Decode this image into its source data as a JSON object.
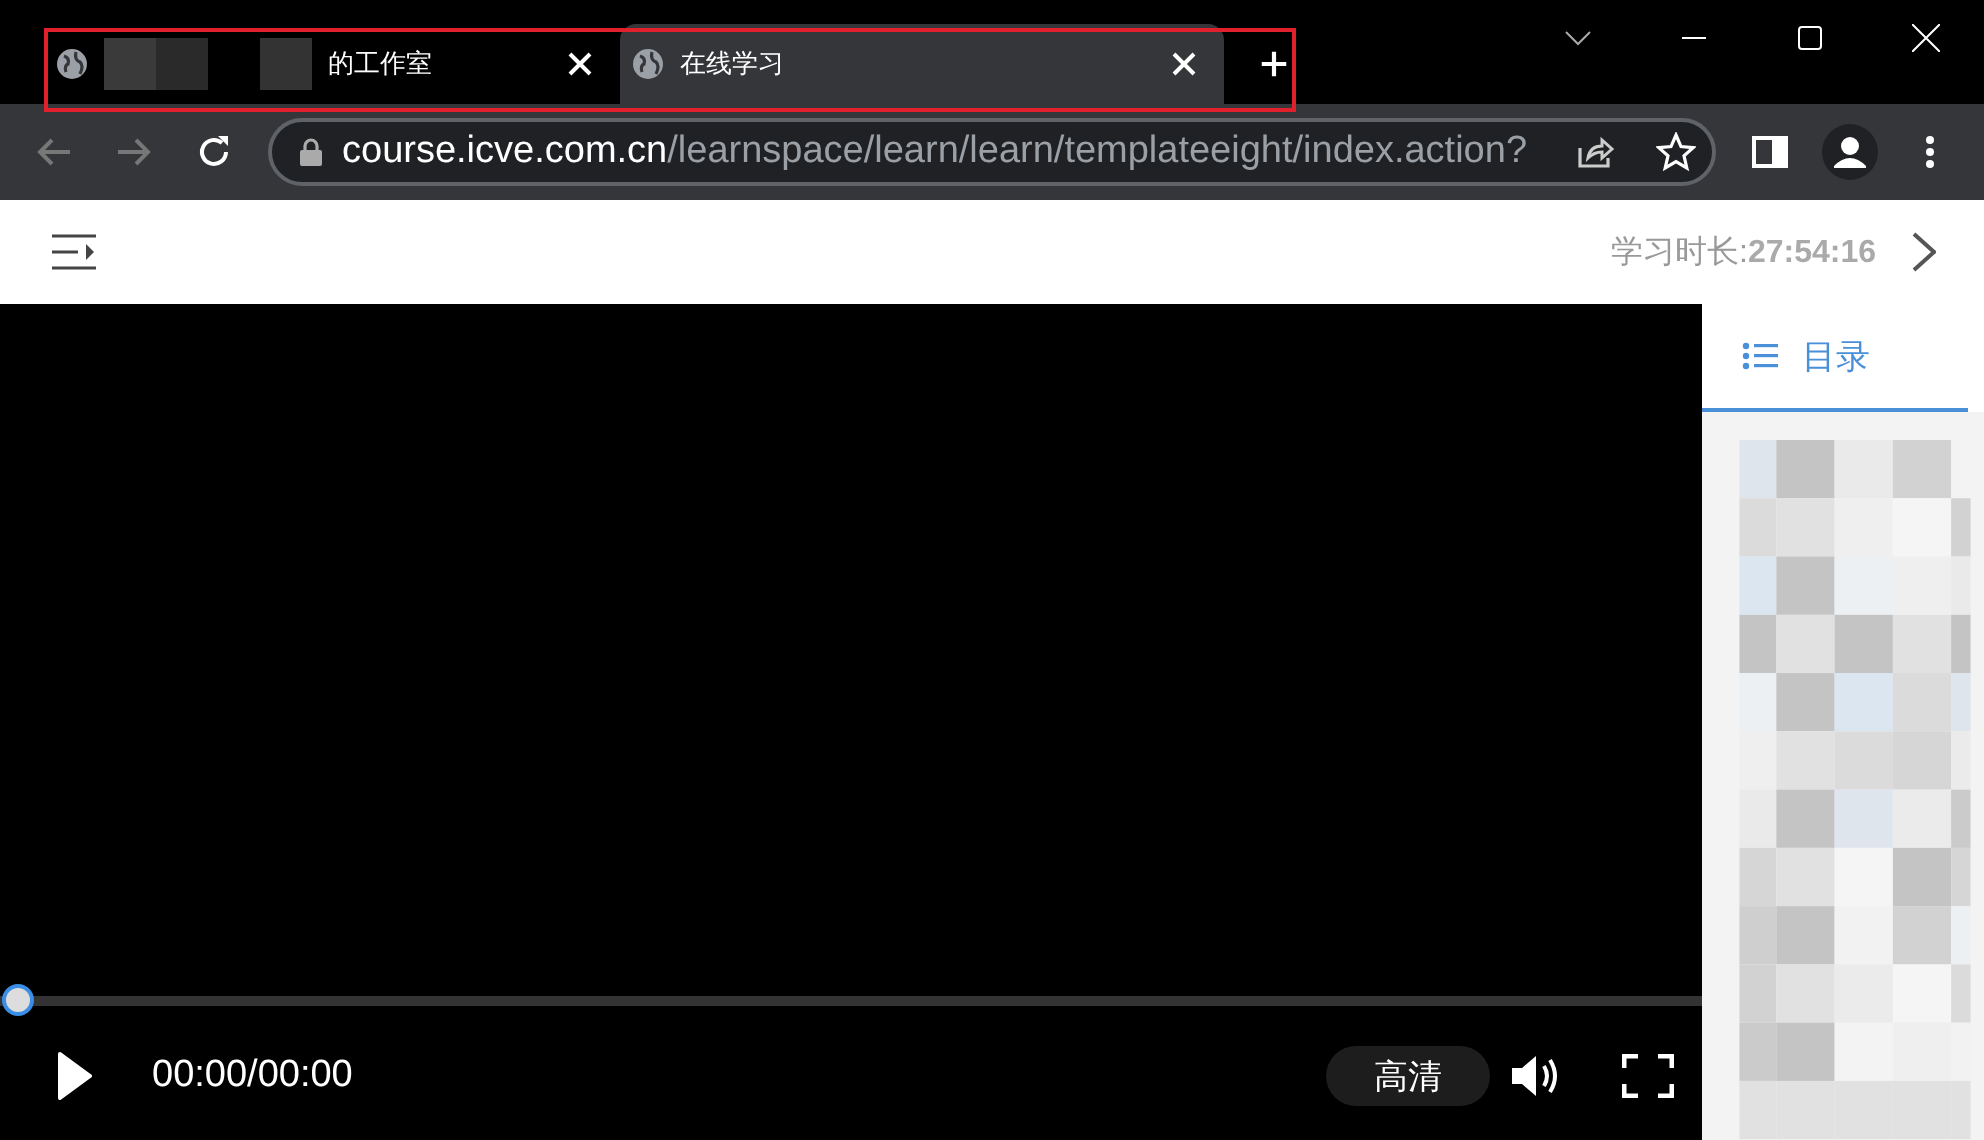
{
  "browser": {
    "tabs": [
      {
        "title": "的工作室",
        "redacted": true,
        "selected": false
      },
      {
        "title": "在线学习",
        "redacted": false,
        "selected": true
      }
    ],
    "address": {
      "host": "course.icve.com.cn",
      "path": "/learnspace/learn/learn/templateeight/index.action?"
    }
  },
  "header": {
    "study_time_label": "学习时长:",
    "study_time": "27:54:16"
  },
  "player": {
    "progress": {
      "level": 0
    },
    "time": "00:00/00:00",
    "quality": "高清"
  },
  "sidebar": {
    "tabs": [
      {
        "label": "目录",
        "selected": true
      }
    ]
  }
}
